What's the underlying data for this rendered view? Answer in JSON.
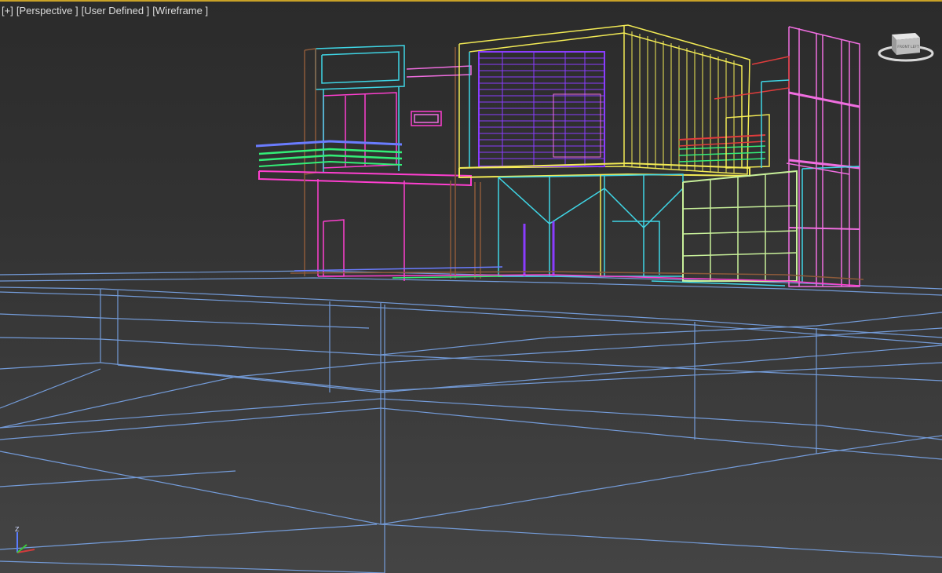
{
  "viewport": {
    "labels": {
      "plus": "[+]",
      "view": "[Perspective ]",
      "camera": "[User Defined ]",
      "shading": "[Wireframe ]"
    },
    "viewcube": {
      "icon": "viewcube-icon",
      "face_text": "FRONT LEFT"
    },
    "axis_tripod": {
      "icon": "axis-tripod-icon",
      "z_label": "Z"
    }
  },
  "colors": {
    "background_top": "#2b2b2b",
    "background_bottom": "#444444",
    "active_viewport_border": "#c9a227",
    "terrain_wire": "#7aa6ea",
    "cyan": "#3fd6e6",
    "magenta": "#ff3fd0",
    "yellow": "#f2ea55",
    "purple": "#8a3cff",
    "green": "#33ee77",
    "light_green": "#c8f09a",
    "blue": "#6a7cff",
    "pink": "#f06ee0",
    "brown": "#8c5a3a",
    "red": "#e03c3c"
  }
}
